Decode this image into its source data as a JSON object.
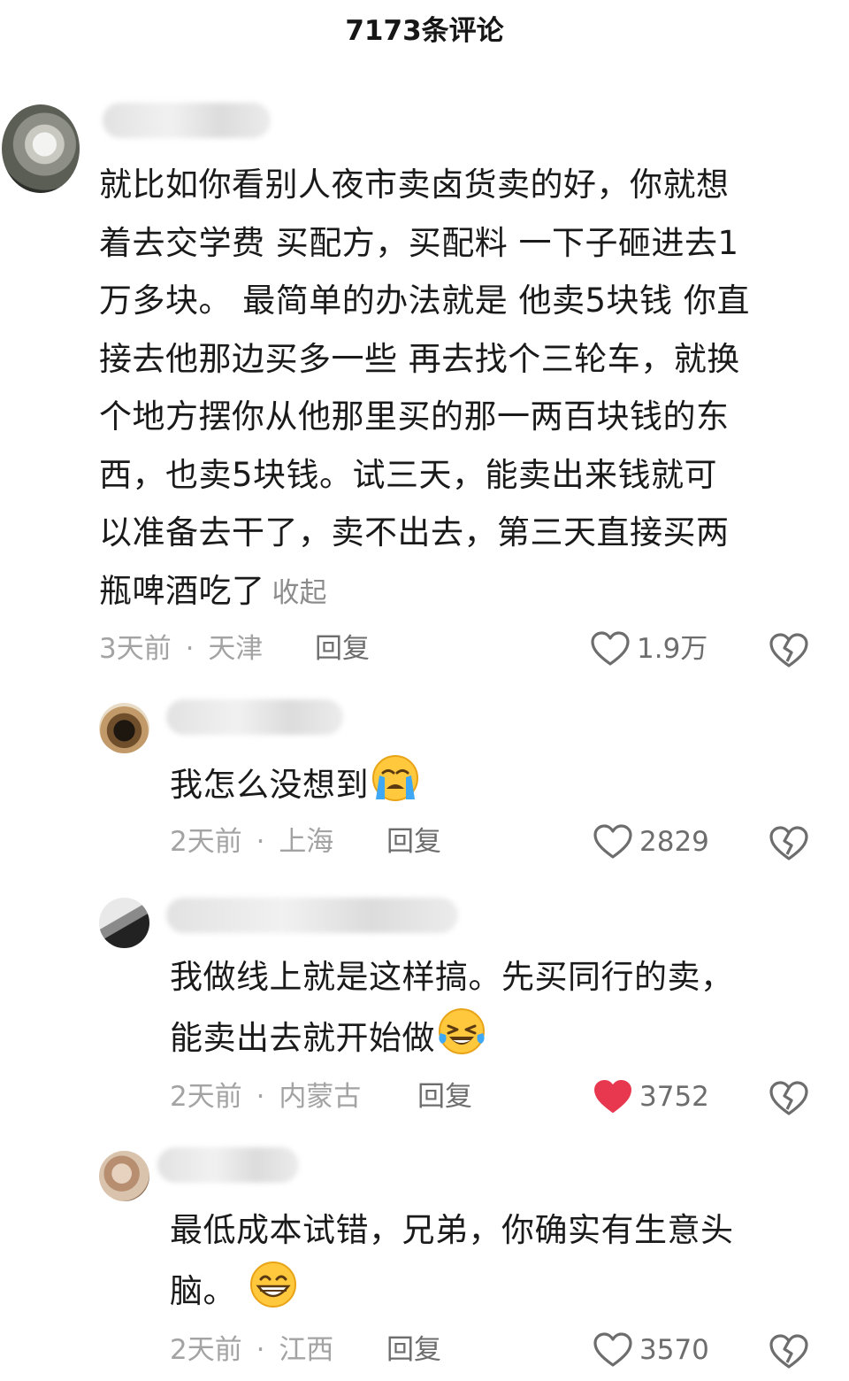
{
  "header": {
    "title": "7173条评论"
  },
  "comments": [
    {
      "text_lines": [
        "就比如你看别人夜市卖卤货卖的好，你就想",
        "着去交学费 买配方，买配料 一下子砸进去1",
        "万多块。 最简单的办法就是 他卖5块钱 你直",
        "接去他那边买多一些 再去找个三轮车，就换",
        "个地方摆你从他那里买的那一两百块钱的东",
        "西，也卖5块钱。试三天，能卖出来钱就可",
        "以准备去干了，卖不出去，第三天直接买两",
        "瓶啤酒吃了"
      ],
      "collapse_label": "收起",
      "time": "3天前",
      "location": "天津",
      "reply_label": "回复",
      "likes": "1.9万",
      "liked": false
    },
    {
      "text": "我怎么没想到",
      "emoji": "crying-face",
      "time": "2天前",
      "location": "上海",
      "reply_label": "回复",
      "likes": "2829",
      "liked": false
    },
    {
      "text_lines": [
        "我做线上就是这样搞。先买同行的卖，",
        "能卖出去就开始做"
      ],
      "emoji": "laughing-crying-face",
      "time": "2天前",
      "location": "内蒙古",
      "reply_label": "回复",
      "likes": "3752",
      "liked": true
    },
    {
      "text_lines": [
        "最低成本试错，兄弟，你确实有生意头",
        "脑。"
      ],
      "emoji": "grinning-face",
      "time": "2天前",
      "location": "江西",
      "reply_label": "回复",
      "likes": "3570",
      "liked": false
    }
  ],
  "colors": {
    "like_active": "#e8384f",
    "text_primary": "#1a1a1a",
    "text_meta": "#a3a3a3"
  },
  "separator": "·"
}
